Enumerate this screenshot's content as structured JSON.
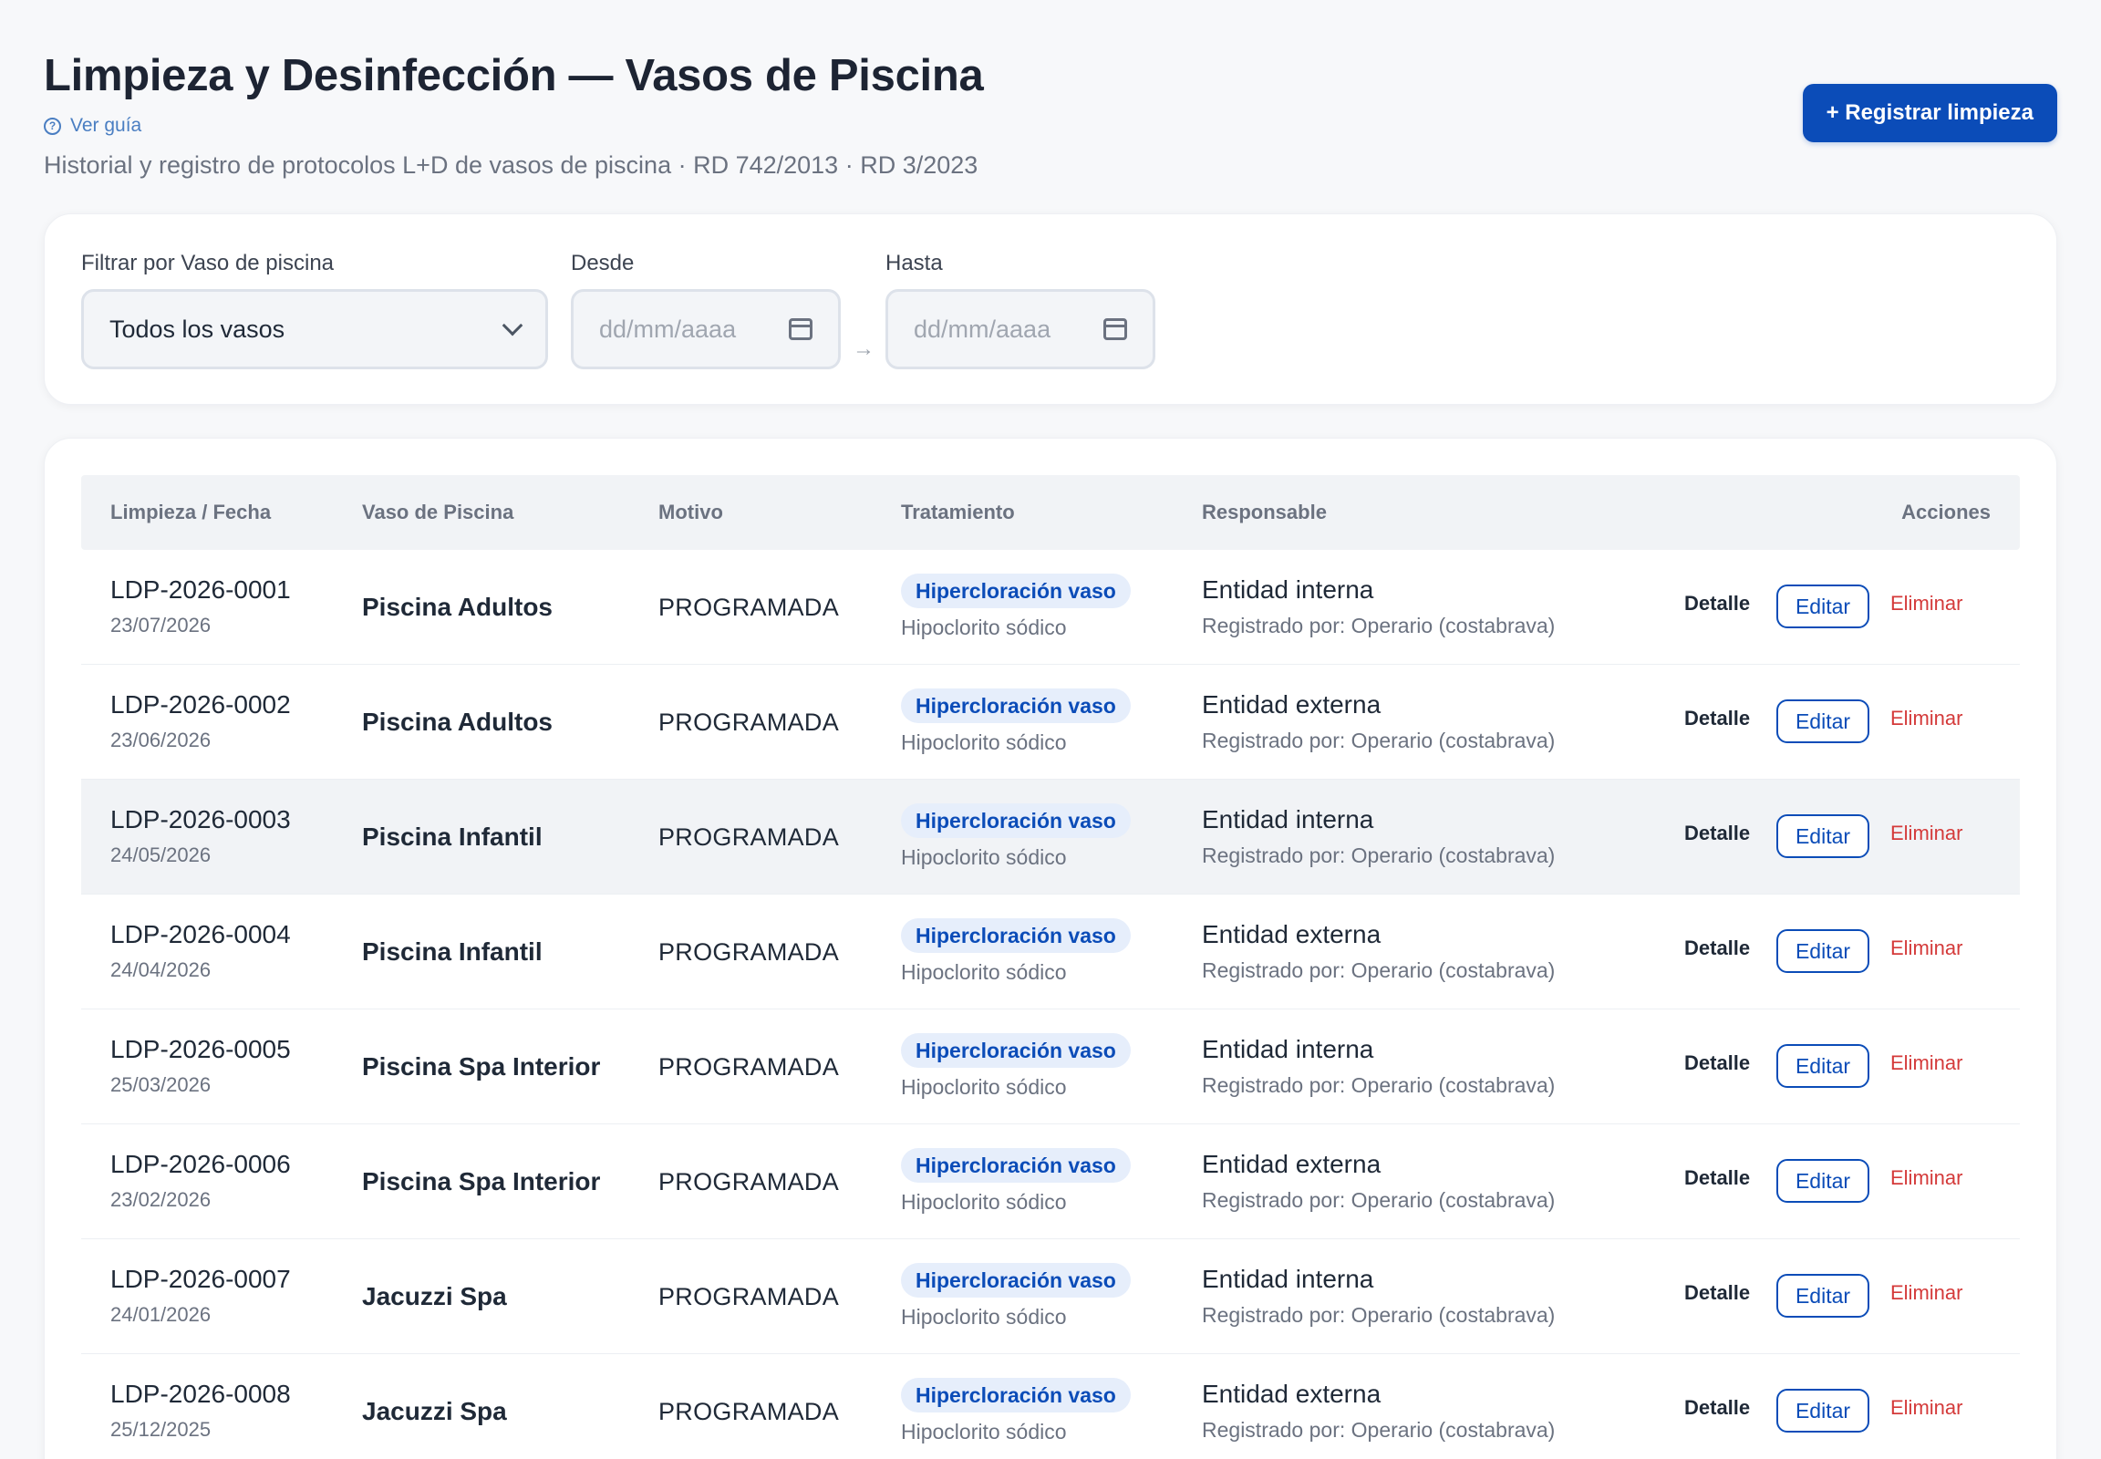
{
  "header": {
    "title": "Limpieza y Desinfección — Vasos de Piscina",
    "guide_label": "Ver guía",
    "subtitle": "Historial y registro de protocolos L+D de vasos de piscina · RD 742/2013 · RD 3/2023",
    "primary_button": "+ Registrar limpieza"
  },
  "filters": {
    "vaso_label": "Filtrar por Vaso de piscina",
    "vaso_value": "Todos los vasos",
    "desde_label": "Desde",
    "desde_placeholder": "dd/mm/aaaa",
    "hasta_label": "Hasta",
    "hasta_placeholder": "dd/mm/aaaa",
    "range_separator": "→"
  },
  "table": {
    "columns": [
      "Limpieza / Fecha",
      "Vaso de Piscina",
      "Motivo",
      "Tratamiento",
      "Responsable",
      "Acciones"
    ],
    "actions": {
      "detail": "Detalle",
      "edit": "Editar",
      "delete": "Eliminar"
    },
    "rows": [
      {
        "code": "LDP-2026-0001",
        "date": "23/07/2026",
        "vaso": "Piscina Adultos",
        "motivo": "PROGRAMADA",
        "tratamiento": "Hipercloración vaso",
        "producto": "Hipoclorito sódico",
        "responsable": "Entidad interna",
        "registrado": "Registrado por: Operario (costabrava)"
      },
      {
        "code": "LDP-2026-0002",
        "date": "23/06/2026",
        "vaso": "Piscina Adultos",
        "motivo": "PROGRAMADA",
        "tratamiento": "Hipercloración vaso",
        "producto": "Hipoclorito sódico",
        "responsable": "Entidad externa",
        "registrado": "Registrado por: Operario (costabrava)"
      },
      {
        "code": "LDP-2026-0003",
        "date": "24/05/2026",
        "vaso": "Piscina Infantil",
        "motivo": "PROGRAMADA",
        "tratamiento": "Hipercloración vaso",
        "producto": "Hipoclorito sódico",
        "responsable": "Entidad interna",
        "registrado": "Registrado por: Operario (costabrava)"
      },
      {
        "code": "LDP-2026-0004",
        "date": "24/04/2026",
        "vaso": "Piscina Infantil",
        "motivo": "PROGRAMADA",
        "tratamiento": "Hipercloración vaso",
        "producto": "Hipoclorito sódico",
        "responsable": "Entidad externa",
        "registrado": "Registrado por: Operario (costabrava)"
      },
      {
        "code": "LDP-2026-0005",
        "date": "25/03/2026",
        "vaso": "Piscina Spa Interior",
        "motivo": "PROGRAMADA",
        "tratamiento": "Hipercloración vaso",
        "producto": "Hipoclorito sódico",
        "responsable": "Entidad interna",
        "registrado": "Registrado por: Operario (costabrava)"
      },
      {
        "code": "LDP-2026-0006",
        "date": "23/02/2026",
        "vaso": "Piscina Spa Interior",
        "motivo": "PROGRAMADA",
        "tratamiento": "Hipercloración vaso",
        "producto": "Hipoclorito sódico",
        "responsable": "Entidad externa",
        "registrado": "Registrado por: Operario (costabrava)"
      },
      {
        "code": "LDP-2026-0007",
        "date": "24/01/2026",
        "vaso": "Jacuzzi Spa",
        "motivo": "PROGRAMADA",
        "tratamiento": "Hipercloración vaso",
        "producto": "Hipoclorito sódico",
        "responsable": "Entidad interna",
        "registrado": "Registrado por: Operario (costabrava)"
      },
      {
        "code": "LDP-2026-0008",
        "date": "25/12/2025",
        "vaso": "Jacuzzi Spa",
        "motivo": "PROGRAMADA",
        "tratamiento": "Hipercloración vaso",
        "producto": "Hipoclorito sódico",
        "responsable": "Entidad externa",
        "registrado": "Registrado por: Operario (costabrava)"
      }
    ]
  },
  "colors": {
    "primary": "#0b4cb8",
    "danger": "#d43a3a",
    "badge_bg": "#e6eefb",
    "link": "#4a7ec2"
  }
}
